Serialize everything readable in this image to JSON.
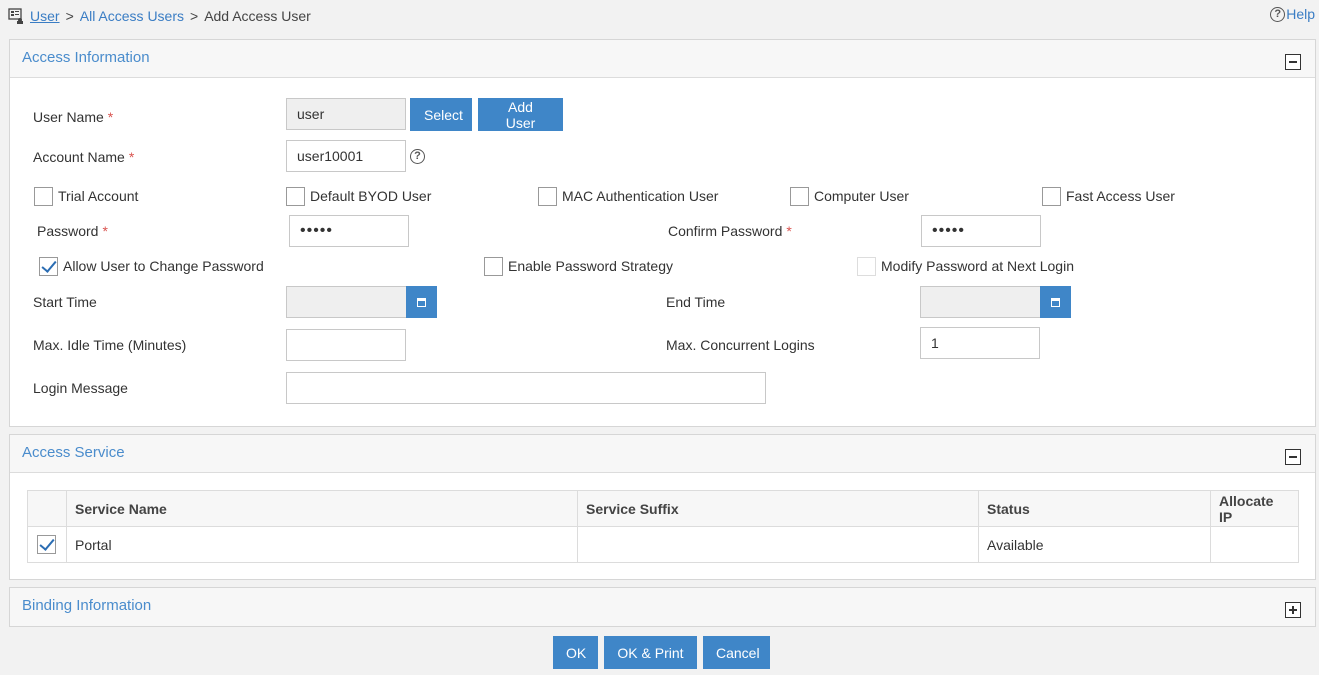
{
  "breadcrumb": {
    "home": "User",
    "sep1": ">",
    "all_users": "All Access Users",
    "sep2": ">",
    "current": "Add Access User"
  },
  "help": {
    "label": "Help"
  },
  "access_info": {
    "title": "Access Information",
    "user_name": {
      "label": "User Name",
      "value": "user",
      "select_label": "Select",
      "add_user_label": "Add User"
    },
    "account_name": {
      "label": "Account Name",
      "value": "user10001"
    },
    "required_mark": "*",
    "checkboxes": [
      {
        "label": "Trial Account",
        "checked": false
      },
      {
        "label": "Default BYOD User",
        "checked": false
      },
      {
        "label": "MAC Authentication User",
        "checked": false
      },
      {
        "label": "Computer User",
        "checked": false
      },
      {
        "label": "Fast Access User",
        "checked": false
      }
    ],
    "password": {
      "label": "Password",
      "value": "•••••"
    },
    "confirm_password": {
      "label": "Confirm Password",
      "value": "•••••"
    },
    "options": [
      {
        "label": "Allow User to Change Password",
        "checked": true
      },
      {
        "label": "Enable Password Strategy",
        "checked": false
      },
      {
        "label": "Modify Password at Next Login",
        "checked": false,
        "disabled": true
      }
    ],
    "start_time": {
      "label": "Start Time",
      "value": ""
    },
    "end_time": {
      "label": "End Time",
      "value": ""
    },
    "max_idle": {
      "label": "Max. Idle Time (Minutes)",
      "value": ""
    },
    "max_concurrent": {
      "label": "Max. Concurrent Logins",
      "value": "1"
    },
    "login_message": {
      "label": "Login Message",
      "value": ""
    }
  },
  "access_service": {
    "title": "Access Service",
    "columns": [
      "Service Name",
      "Service Suffix",
      "Status",
      "Allocate IP"
    ],
    "rows": [
      {
        "checked": true,
        "service_name": "Portal",
        "service_suffix": "",
        "status": "Available",
        "allocate_ip": ""
      }
    ]
  },
  "binding_info": {
    "title": "Binding Information"
  },
  "footer": {
    "ok": "OK",
    "ok_print": "OK & Print",
    "cancel": "Cancel"
  },
  "colors": {
    "accent": "#3f86c8",
    "title_blue": "#4a8ccc",
    "required": "#d9534f"
  },
  "icons": {
    "home": "user-list-icon",
    "help": "question-circle-icon",
    "calendar": "calendar-icon"
  }
}
